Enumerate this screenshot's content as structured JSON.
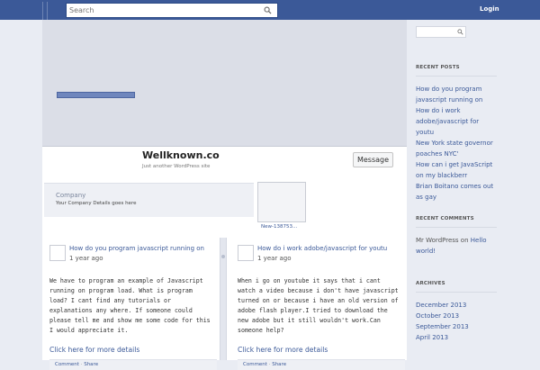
{
  "topbar": {
    "search_placeholder": "Search",
    "login_label": "Login"
  },
  "profile": {
    "site_title": "Wellknown.co",
    "tagline": "Just another WordPress site",
    "message_button": "Message",
    "company_title": "Company",
    "company_desc": "Your Company Details goes here",
    "thumb_label": "New-138753..."
  },
  "posts": [
    {
      "title": "How do you program javascript running on",
      "time": "1 year ago",
      "body": "We have to program an example of Javascript running on program load. What is program load? I cant find any tutorials or explanations any where. If someone could please tell me and show me some code for this I would appreciate it.",
      "more": "Click here for more details",
      "comment": "Comment",
      "share": "Share"
    },
    {
      "title": "How do i work adobe/javascript for youtu",
      "time": "1 year ago",
      "body": "When i go on youtube it says that i cant watch a video because i don't have javascript turned on or because i have an old version of adobe flash player.I tried to download the new adobe but it still wouldn't work.Can someone help?",
      "more": "Click here for more details",
      "comment": "Comment",
      "share": "Share"
    }
  ],
  "sidebar": {
    "recent_posts_heading": "RECENT POSTS",
    "recent_posts": [
      "How do you program javascript running on",
      "How do i work adobe/javascript for youtu",
      "New York state governor poaches NYC'",
      "How can i get JavaScript on my blackberr",
      "Brian Boitano comes out as gay"
    ],
    "recent_comments_heading": "RECENT COMMENTS",
    "recent_comment": {
      "author": "Mr WordPress",
      "on": "on",
      "post": "Hello world!"
    },
    "archives_heading": "ARCHIVES",
    "archives": [
      "December 2013",
      "October 2013",
      "September 2013",
      "April 2013"
    ]
  },
  "colors": {
    "topbar": "#3b5998",
    "link": "#3b5998",
    "background": "#e9ecf3"
  }
}
